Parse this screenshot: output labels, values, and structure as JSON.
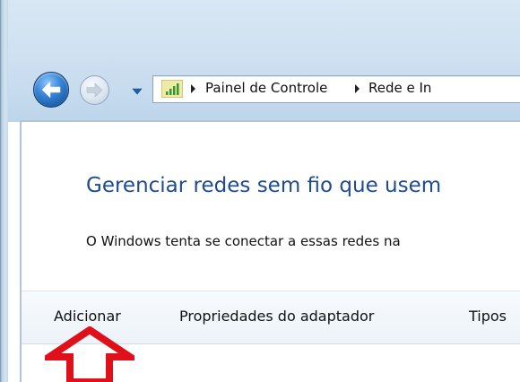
{
  "navigation": {
    "back_icon": "back-arrow-icon",
    "forward_icon": "forward-arrow-icon",
    "history_icon": "chevron-down-icon"
  },
  "address_bar": {
    "location_icon": "network-signal-icon",
    "breadcrumbs": [
      "Painel de Controle",
      "Rede e In"
    ]
  },
  "page": {
    "title": "Gerenciar redes sem fio que usem",
    "description": "O Windows tenta se conectar a essas redes na"
  },
  "command_bar": {
    "items": [
      "Adicionar",
      "Propriedades do adaptador",
      "Tipos"
    ]
  },
  "annotation": {
    "icon": "red-up-arrow-icon",
    "color": "#e0101a"
  },
  "colors": {
    "title": "#1e4c8f",
    "chrome": "#cfe1f1"
  }
}
